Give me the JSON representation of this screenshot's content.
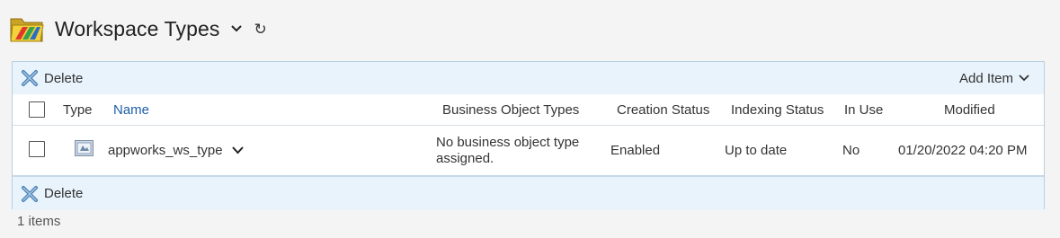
{
  "header": {
    "title": "Workspace Types",
    "icon": "folder-icon",
    "refresh_glyph": "↻"
  },
  "toolbar": {
    "delete_label": "Delete",
    "add_item_label": "Add Item"
  },
  "columns": {
    "type": "Type",
    "name": "Name",
    "business_object_types": "Business Object Types",
    "creation_status": "Creation Status",
    "indexing_status": "Indexing Status",
    "in_use": "In Use",
    "modified": "Modified"
  },
  "rows": [
    {
      "name": "appworks_ws_type",
      "business_object_types_line1": "No business object type",
      "business_object_types_line2": "assigned.",
      "creation_status": "Enabled",
      "indexing_status": "Up to date",
      "in_use": "No",
      "modified": "01/20/2022 04:20 PM",
      "icon": "workspace-type-icon"
    }
  ],
  "footer": {
    "count_text": "1 items"
  },
  "colors": {
    "toolbar_bg": "#e8f3fb",
    "link": "#1f5fa8",
    "border": "#b7cfe0"
  }
}
